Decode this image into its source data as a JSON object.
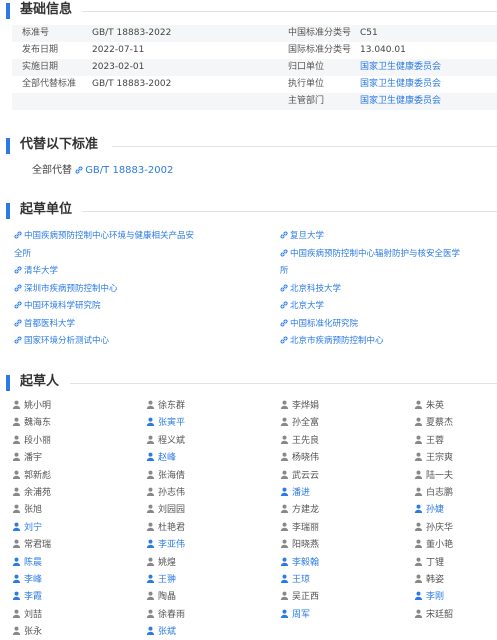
{
  "basic_info": {
    "title": "基础信息",
    "rows": [
      {
        "l1": "标准号",
        "v1": "GB/T 18883-2022",
        "l2": "中国标准分类号",
        "v2": "C51"
      },
      {
        "l1": "发布日期",
        "v1": "2022-07-11",
        "l2": "国际标准分类号",
        "v2": "13.040.01"
      },
      {
        "l1": "实施日期",
        "v1": "2023-02-01",
        "l2": "归口单位",
        "v2": "国家卫生健康委员会"
      },
      {
        "l1": "全部代替标准",
        "v1": "GB/T 18883-2002",
        "l2": "执行单位",
        "v2": "国家卫生健康委员会"
      },
      {
        "l1": "",
        "v1": "",
        "l2": "主管部门",
        "v2": "国家卫生健康委员会"
      }
    ]
  },
  "replaces": {
    "title": "代替以下标准",
    "label": "全部代替",
    "link": "GB/T 18883-2002"
  },
  "drafting_units": {
    "title": "起草单位",
    "left": [
      "中国疾病预防控制中心环境与健康相关产品安",
      "全所",
      "清华大学",
      "深圳市疾病预防控制中心",
      "中国环境科学研究院",
      "首都医科大学",
      "国家环境分析测试中心"
    ],
    "right": [
      "复旦大学",
      "中国疾病预防控制中心辐射防护与核安全医学",
      "所",
      "北京科技大学",
      "北京大学",
      "中国标准化研究院",
      "北京市疾病预防控制中心"
    ]
  },
  "drafters": {
    "title": "起草人",
    "col1": [
      "姚小明",
      "魏海东",
      "段小丽",
      "潘宇",
      "郭新彪",
      "余浦苑",
      "张旭",
      "刘宁",
      "常君瑞",
      "陈晨",
      "李峰",
      "李霞",
      "刘喆",
      "张永"
    ],
    "col2": [
      "徐东群",
      "张寅平",
      "程义斌",
      "赵峰",
      "张海倩",
      "孙志伟",
      "刘园园",
      "杜艳君",
      "李亚伟",
      "姚煌",
      "王翀",
      "陶晶",
      "徐春雨",
      "张斌"
    ],
    "col3": [
      "李烨娟",
      "孙全富",
      "王先良",
      "杨晓伟",
      "武云云",
      "潘进",
      "方建龙",
      "李瑞丽",
      "阳晓燕",
      "李毅翰",
      "王琼",
      "吴正西",
      "周军",
      ""
    ],
    "col4": [
      "朱英",
      "夏蔡杰",
      "王蓉",
      "王宗爽",
      "陆一夫",
      "白志鹏",
      "孙婕",
      "孙庆华",
      "董小艳",
      "丁锂",
      "韩姿",
      "李刚",
      "宋廷韶",
      ""
    ],
    "col1_hl": [
      7,
      9,
      10,
      11
    ],
    "col2_hl": [
      1,
      3,
      8,
      10,
      13
    ],
    "col3_hl": [
      5,
      9,
      10,
      12
    ],
    "col4_hl": [
      6,
      11
    ]
  },
  "colors": {
    "accent": "#2c7be5",
    "text": "#333333",
    "shade": "#f5f6f7"
  }
}
